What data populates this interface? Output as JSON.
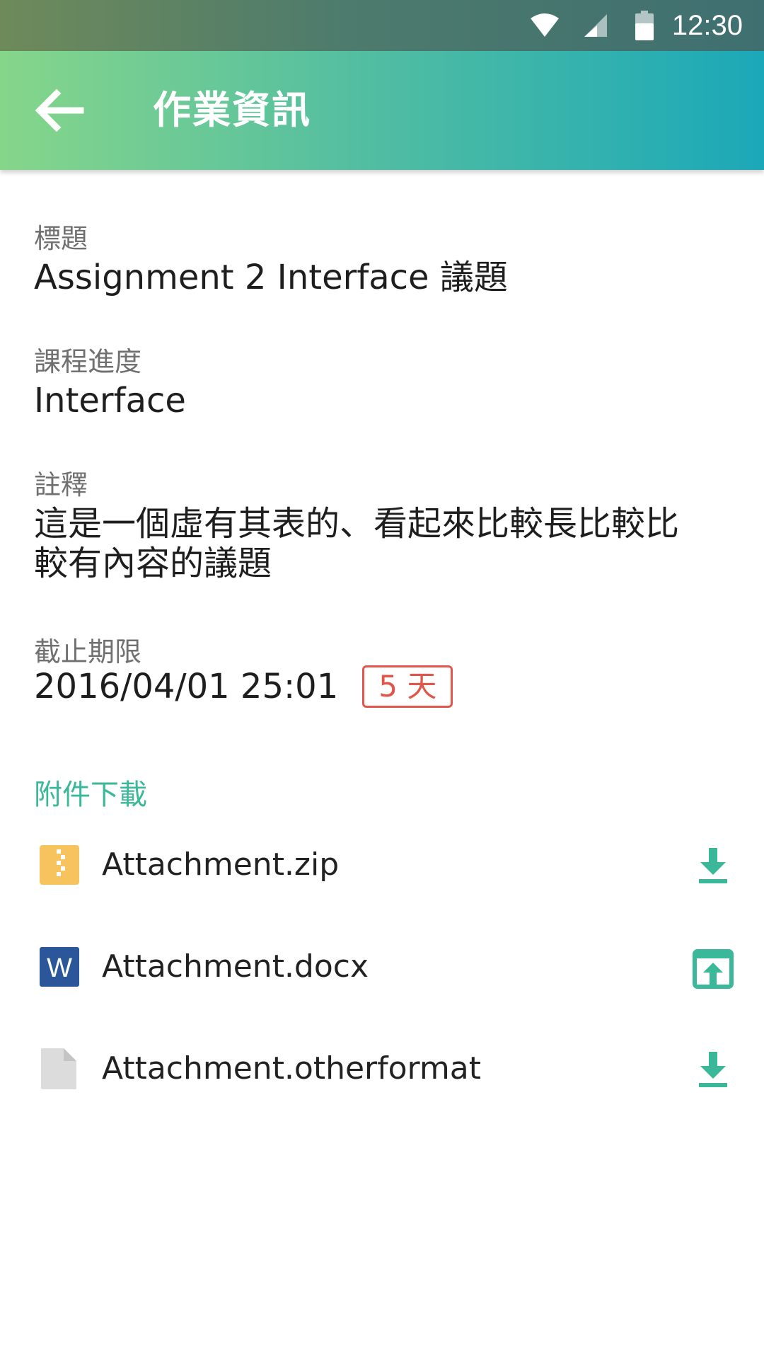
{
  "status_bar": {
    "time": "12:30"
  },
  "app_bar": {
    "title": "作業資訊"
  },
  "fields": {
    "title_label": "標題",
    "title_value": "Assignment 2 Interface 議題",
    "progress_label": "課程進度",
    "progress_value": "Interface",
    "note_label": "註釋",
    "note_value_line1": "這是一個虛有其表的、看起來比較長比較比",
    "note_value_line2": "較有內容的議題",
    "deadline_label": "截止期限",
    "deadline_value": "2016/04/01 25:01",
    "deadline_badge": "5 天"
  },
  "attachments": {
    "section_title": "附件下載",
    "items": [
      {
        "name": "Attachment.zip",
        "icon": "zip-file-icon",
        "action": "download-icon"
      },
      {
        "name": "Attachment.docx",
        "icon": "word-file-icon",
        "action": "open-external-icon"
      },
      {
        "name": "Attachment.otherformat",
        "icon": "generic-file-icon",
        "action": "download-icon"
      }
    ]
  },
  "colors": {
    "accent": "#3bb89a",
    "badge": "#e0564a",
    "zip_icon": "#f7c35f",
    "word_icon": "#2b579a",
    "generic_icon": "#dcdcdc"
  }
}
